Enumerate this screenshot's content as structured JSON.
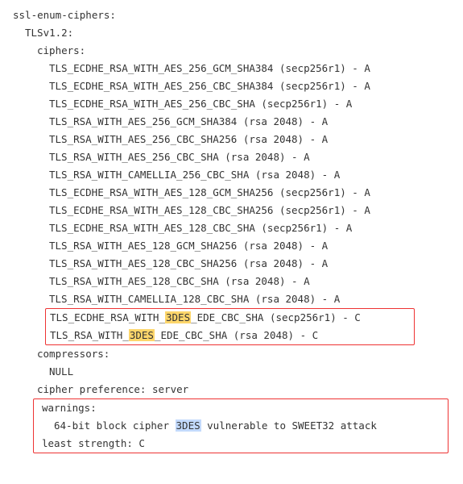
{
  "title": "ssl-enum-ciphers:",
  "proto": "TLSv1.2:",
  "ciphers_label": "ciphers:",
  "ciphers": [
    "TLS_ECDHE_RSA_WITH_AES_256_GCM_SHA384 (secp256r1) - A",
    "TLS_ECDHE_RSA_WITH_AES_256_CBC_SHA384 (secp256r1) - A",
    "TLS_ECDHE_RSA_WITH_AES_256_CBC_SHA (secp256r1) - A",
    "TLS_RSA_WITH_AES_256_GCM_SHA384 (rsa 2048) - A",
    "TLS_RSA_WITH_AES_256_CBC_SHA256 (rsa 2048) - A",
    "TLS_RSA_WITH_AES_256_CBC_SHA (rsa 2048) - A",
    "TLS_RSA_WITH_CAMELLIA_256_CBC_SHA (rsa 2048) - A",
    "TLS_ECDHE_RSA_WITH_AES_128_GCM_SHA256 (secp256r1) - A",
    "TLS_ECDHE_RSA_WITH_AES_128_CBC_SHA256 (secp256r1) - A",
    "TLS_ECDHE_RSA_WITH_AES_128_CBC_SHA (secp256r1) - A",
    "TLS_RSA_WITH_AES_128_GCM_SHA256 (rsa 2048) - A",
    "TLS_RSA_WITH_AES_128_CBC_SHA256 (rsa 2048) - A",
    "TLS_RSA_WITH_AES_128_CBC_SHA (rsa 2048) - A",
    "TLS_RSA_WITH_CAMELLIA_128_CBC_SHA (rsa 2048) - A"
  ],
  "highlight_token": "3DES",
  "weak": [
    {
      "pre": "TLS_ECDHE_RSA_WITH_",
      "post": "_EDE_CBC_SHA (secp256r1) - C"
    },
    {
      "pre": "TLS_RSA_WITH_",
      "post": "_EDE_CBC_SHA (rsa 2048) - C"
    }
  ],
  "compressors_label": "compressors:",
  "compressors_value": "NULL",
  "cipher_pref": "cipher preference: server",
  "warnings_label": "warnings:",
  "warning_pre": "64-bit block cipher ",
  "warning_post": " vulnerable to SWEET32 attack",
  "least_strength": "least strength: C"
}
